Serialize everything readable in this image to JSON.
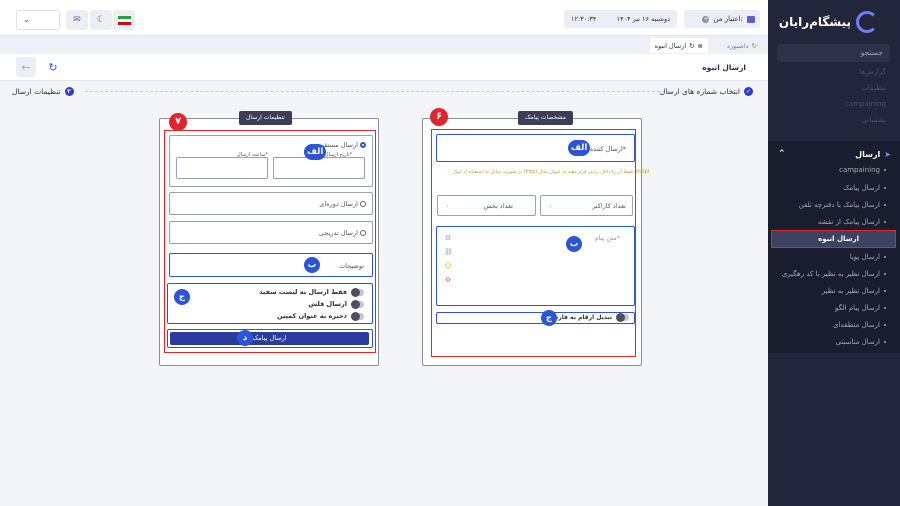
{
  "sidebar": {
    "brand": "پیشگام‌رایان",
    "search": "جستجو",
    "faded": [
      "گزارش‌ها",
      "تنظیمات",
      "campaining",
      "پشتیبانی"
    ],
    "group_title": "ارسال",
    "items": [
      "campaining",
      "ارسال پیامک",
      "ارسال پیامک با دفترچه تلفن",
      "ارسال پیامک از نقشه",
      "ارسال انبوه",
      "ارسال پویا",
      "ارسال نظیر به نظیر با کد رهگیری",
      "ارسال نظیر به نظیر",
      "ارسال پیام الگو",
      "ارسال منطقه‌ای",
      "ارسال مناسبتی"
    ],
    "active": "ارسال انبوه"
  },
  "topbar": {
    "credit": "اعتبار من:",
    "date": "دوشنبه ۱۶ تیر ۱۴۰۴",
    "time": "۱۲:۳۰:۳۴",
    "lang": "fa",
    "flag": "iran-flag"
  },
  "tabs": [
    {
      "label": "داشبورد"
    },
    {
      "label": "ارسال انبوه"
    }
  ],
  "page": {
    "title": "ارسال انبوه"
  },
  "steps": [
    {
      "num": "۱",
      "label": "انتخاب شماره های ارسال"
    },
    {
      "num": "۲",
      "label": "تنظیمات ارسال"
    }
  ],
  "sms_card": {
    "title": "مشخصات پیامک",
    "badge": "۶",
    "sender_label": "ارسال کننده*",
    "sender_badge": "الف",
    "warning": "در صورت تمایل به استفاده از لینک (http) فقط آن را داخل پرانتز قرار دهید به عنوان مثال: (http)",
    "char_count_label": "تعداد کاراکتر",
    "char_count": "۰",
    "parts_label": "تعداد بخش",
    "parts": "۰",
    "message_placeholder": "متن پیام*",
    "message_badge": "ب",
    "persian_digits": "تبدیل ارقام به فارسی",
    "persian_badge": "ج"
  },
  "settings_card": {
    "title": "تنظیمات ارسال",
    "badge": "۷",
    "direct": "ارسال مستقیم",
    "date_label": "تاریخ ارسال*",
    "time_label": "ساعت ارسال*",
    "time_badge": "الف",
    "periodic": "ارسال دوره‌ای",
    "gradual": "ارسال تدریجی",
    "desc_label": "توضیحات",
    "desc_badge": "ب",
    "whitelist": "فقط ارسال به لیست سفید",
    "flash": "ارسال فلش",
    "save_campaign": "ذخیره به عنوان کمپین",
    "toggles_badge": "ج",
    "send_label": "ارسال پیامک",
    "send_badge": "د"
  },
  "colors": {
    "sidebar": "#22263a",
    "accent": "#2b55d6",
    "highlight": "#e2242c"
  }
}
